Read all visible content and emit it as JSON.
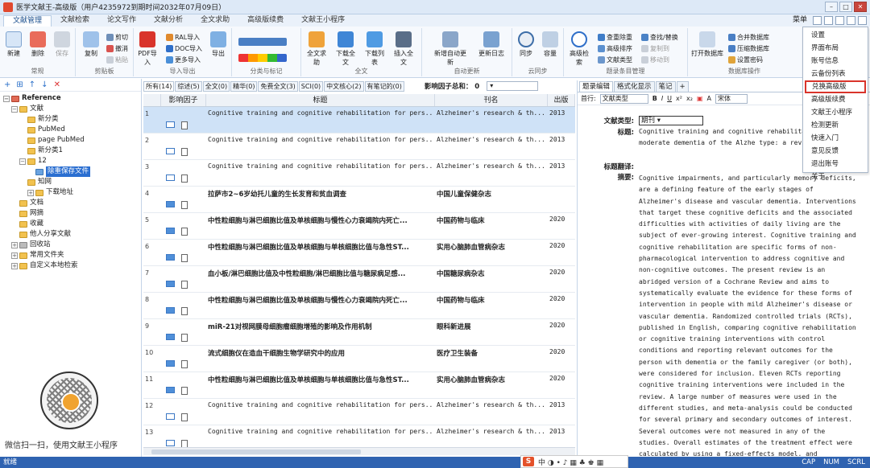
{
  "window": {
    "title": "医学文献王-高级版（用户4235972到期时间2032年07月09日）"
  },
  "ribbon_tabs": [
    "文献管理",
    "文献检索",
    "论文写作",
    "文献分析",
    "全文求助",
    "高级版续费",
    "文献王小程序"
  ],
  "menu_label": "菜单",
  "ribbon": {
    "g1": {
      "label": "常规",
      "b1": "新建",
      "b2": "删除",
      "b3": "保存"
    },
    "g2": {
      "label": "剪贴板",
      "b1": "复制",
      "s1": "剪切",
      "s2": "撤消",
      "s3": "粘贴"
    },
    "g3": {
      "label": "导入导出",
      "b1": "PDF导入",
      "s1": "RAL导入",
      "s2": "DOC导入",
      "s3": "更多导入",
      "b2": "导出"
    },
    "g4": {
      "label": "分类与标记"
    },
    "g5": {
      "label": "全文",
      "b1": "全文求助",
      "b2": "下载全文",
      "b3": "下载列表",
      "b4": "插入全文"
    },
    "g6": {
      "label": "自动更新",
      "b1": "新增自动更新",
      "b2": "更新日志"
    },
    "g7": {
      "label": "云同步",
      "b1": "同步",
      "b2": "容量"
    },
    "g8": {
      "label": "题录条目管理",
      "b1": "高级检索",
      "s1": "查重除重",
      "s2": "高级排序",
      "s3": "文献类型",
      "s4": "查找/替换",
      "s5": "复制到",
      "s6": "移动到"
    },
    "g9": {
      "label": "数据库操作",
      "b1": "打开数据库",
      "s1": "合并数据库",
      "s2": "压缩数据库",
      "s3": "设置密码"
    }
  },
  "tree": {
    "root": "Reference",
    "items": [
      "文献",
      "新分类",
      "PubMed",
      "page PubMed",
      "新分类1",
      "12",
      "除重保存文件",
      "知网",
      "下载地址",
      "文档",
      "网摘",
      "收藏",
      "他人分享文献",
      "回收站",
      "常用文件夹",
      "自定义本地检索"
    ]
  },
  "qr_caption": "微信扫一扫，使用文献王小程序",
  "filters": [
    "所有(14)",
    "综述(5)",
    "全文(0)",
    "精华(0)",
    "免费全文(3)",
    "SCI(0)",
    "中文核心(2)",
    "有笔记的(0)"
  ],
  "if_sum": "影响因子总和： 0",
  "columns": {
    "if": "影响因子",
    "title": "标题",
    "journal": "刊名",
    "year": "出版"
  },
  "rows": [
    {
      "n": "1",
      "title": "Cognitive training and cognitive rehabilitation for pers...",
      "journal": "Alzheimer's research & th...",
      "year": "2013",
      "cn": false
    },
    {
      "n": "2",
      "title": "Cognitive training and cognitive rehabilitation for pers...",
      "journal": "Alzheimer's research & th...",
      "year": "2013",
      "cn": false
    },
    {
      "n": "3",
      "title": "Cognitive training and cognitive rehabilitation for pers...",
      "journal": "Alzheimer's research & th...",
      "year": "2013",
      "cn": false
    },
    {
      "n": "4",
      "title": "拉萨市2~6岁幼托儿童的生长发育和贫血调查",
      "journal": "中国儿童保健杂志",
      "year": "",
      "cn": true
    },
    {
      "n": "5",
      "title": "中性粒细胞与淋巴细胞比值及单核细胞与慢性心力衰竭院内死亡...",
      "journal": "中国药物与临床",
      "year": "2020",
      "cn": true
    },
    {
      "n": "6",
      "title": "中性粒细胞与淋巴细胞比值及单核细胞与单核细胞比值与急性ST...",
      "journal": "实用心脑肺血管病杂志",
      "year": "2020",
      "cn": true
    },
    {
      "n": "7",
      "title": "血小板/淋巴细胞比值及中性粒细胞/淋巴细胞比值与糖尿病足感...",
      "journal": "中国糖尿病杂志",
      "year": "2020",
      "cn": true
    },
    {
      "n": "8",
      "title": "中性粒细胞与淋巴细胞比值及单核细胞与慢性心力衰竭院内死亡...",
      "journal": "中国药物与临床",
      "year": "2020",
      "cn": true
    },
    {
      "n": "9",
      "title": "miR-21对视网膜母细胞瘤细胞增殖的影响及作用机制",
      "journal": "眼科新进展",
      "year": "2020",
      "cn": true
    },
    {
      "n": "10",
      "title": "流式细胞仪在造血干细胞生物学研究中的应用",
      "journal": "医疗卫生装备",
      "year": "2020",
      "cn": true
    },
    {
      "n": "11",
      "title": "中性粒细胞与淋巴细胞比值及单核细胞与单核细胞比值与急性ST...",
      "journal": "实用心脑肺血管病杂志",
      "year": "2020",
      "cn": true
    },
    {
      "n": "12",
      "title": "Cognitive training and cognitive rehabilitation for pers...",
      "journal": "Alzheimer's research & th...",
      "year": "2013",
      "cn": false
    },
    {
      "n": "13",
      "title": "Cognitive training and cognitive rehabilitation for pers...",
      "journal": "Alzheimer's research & th...",
      "year": "2013",
      "cn": false
    }
  ],
  "right": {
    "tabs": [
      "题录编辑",
      "格式化显示",
      "笔记"
    ],
    "toolbar_label": "首行:",
    "toolbar_select": "文献类型",
    "font_select": "宋体",
    "doctype_label": "文献类型:",
    "doctype_value": "期刊",
    "title_label": "标题:",
    "title_text": "Cognitive training and cognitive rehabilita with mild to moderate dementia of the Alzhe type: a review.",
    "trans_label": "标题翻译:",
    "abstract_label": "摘要:",
    "abstract_text": "Cognitive impairments, and particularly memory deficits, are a defining feature of the early stages of Alzheimer's disease and vascular dementia. Interventions that target these cognitive deficits and the associated difficulties with activities of daily living are the subject of ever-growing interest. Cognitive training and cognitive rehabilitation are specific forms of non-pharmacological intervention to address cognitive and non-cognitive outcomes. The present review is an abridged version of a Cochrane Review and aims to systematically evaluate the evidence for these forms of intervention in people with mild Alzheimer's disease or vascular dementia. Randomized controlled trials (RCTs), published in English, comparing cognitive rehabilitation or cognitive training interventions with control conditions and reporting relevant outcomes for the person with dementia or the family caregiver (or both), were considered for inclusion. Eleven RCTs reporting cognitive training interventions were included in the review. A large number of measures were used in the different studies, and meta-analysis could be conducted for several primary and secondary outcomes of interest. Several outcomes were not measured in any of the studies. Overall estimates of the treatment effect were calculated by using a fixed-effects model, and statistical heterogeneity was measured by using a standard chi-squared statistic. One RCT of"
  },
  "dropdown": [
    "设置",
    "界面布局",
    "账号信息",
    "云备份列表",
    "兑换高级版",
    "高级版续费",
    "文献王小程序",
    "检测更新",
    "快速入门",
    "意见反馈",
    "退出账号",
    "关于"
  ],
  "status": {
    "left": "就绪",
    "caps": "CAP",
    "num": "NUM",
    "scrl": "SCRL"
  },
  "ime_label": "S"
}
